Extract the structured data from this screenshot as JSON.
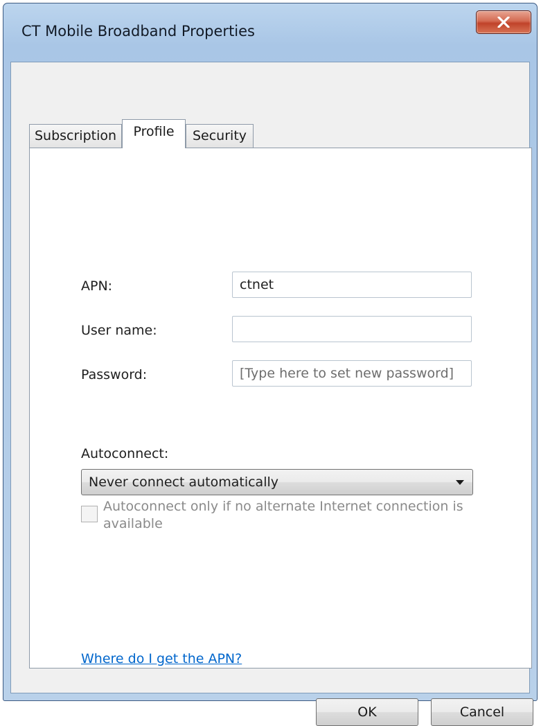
{
  "window": {
    "title": "CT Mobile Broadband Properties",
    "close_icon": "close-icon"
  },
  "tabs": [
    {
      "label": "Subscription",
      "selected": false
    },
    {
      "label": "Profile",
      "selected": true
    },
    {
      "label": "Security",
      "selected": false
    }
  ],
  "profile": {
    "apn_label": "APN:",
    "apn_value": "ctnet",
    "username_label": "User name:",
    "username_value": "",
    "password_label": "Password:",
    "password_placeholder": "[Type here to set new password]",
    "autoconnect_label": "Autoconnect:",
    "autoconnect_selected": "Never connect automatically",
    "checkbox_label": "Autoconnect only if no alternate Internet connection is available",
    "checkbox_checked": false,
    "checkbox_enabled": false,
    "help_link": "Where do I get the APN?"
  },
  "buttons": {
    "ok": "OK",
    "cancel": "Cancel"
  },
  "colors": {
    "link": "#0066cc",
    "close_button": "#c0432a",
    "title_bar": "#a9c6e6"
  }
}
